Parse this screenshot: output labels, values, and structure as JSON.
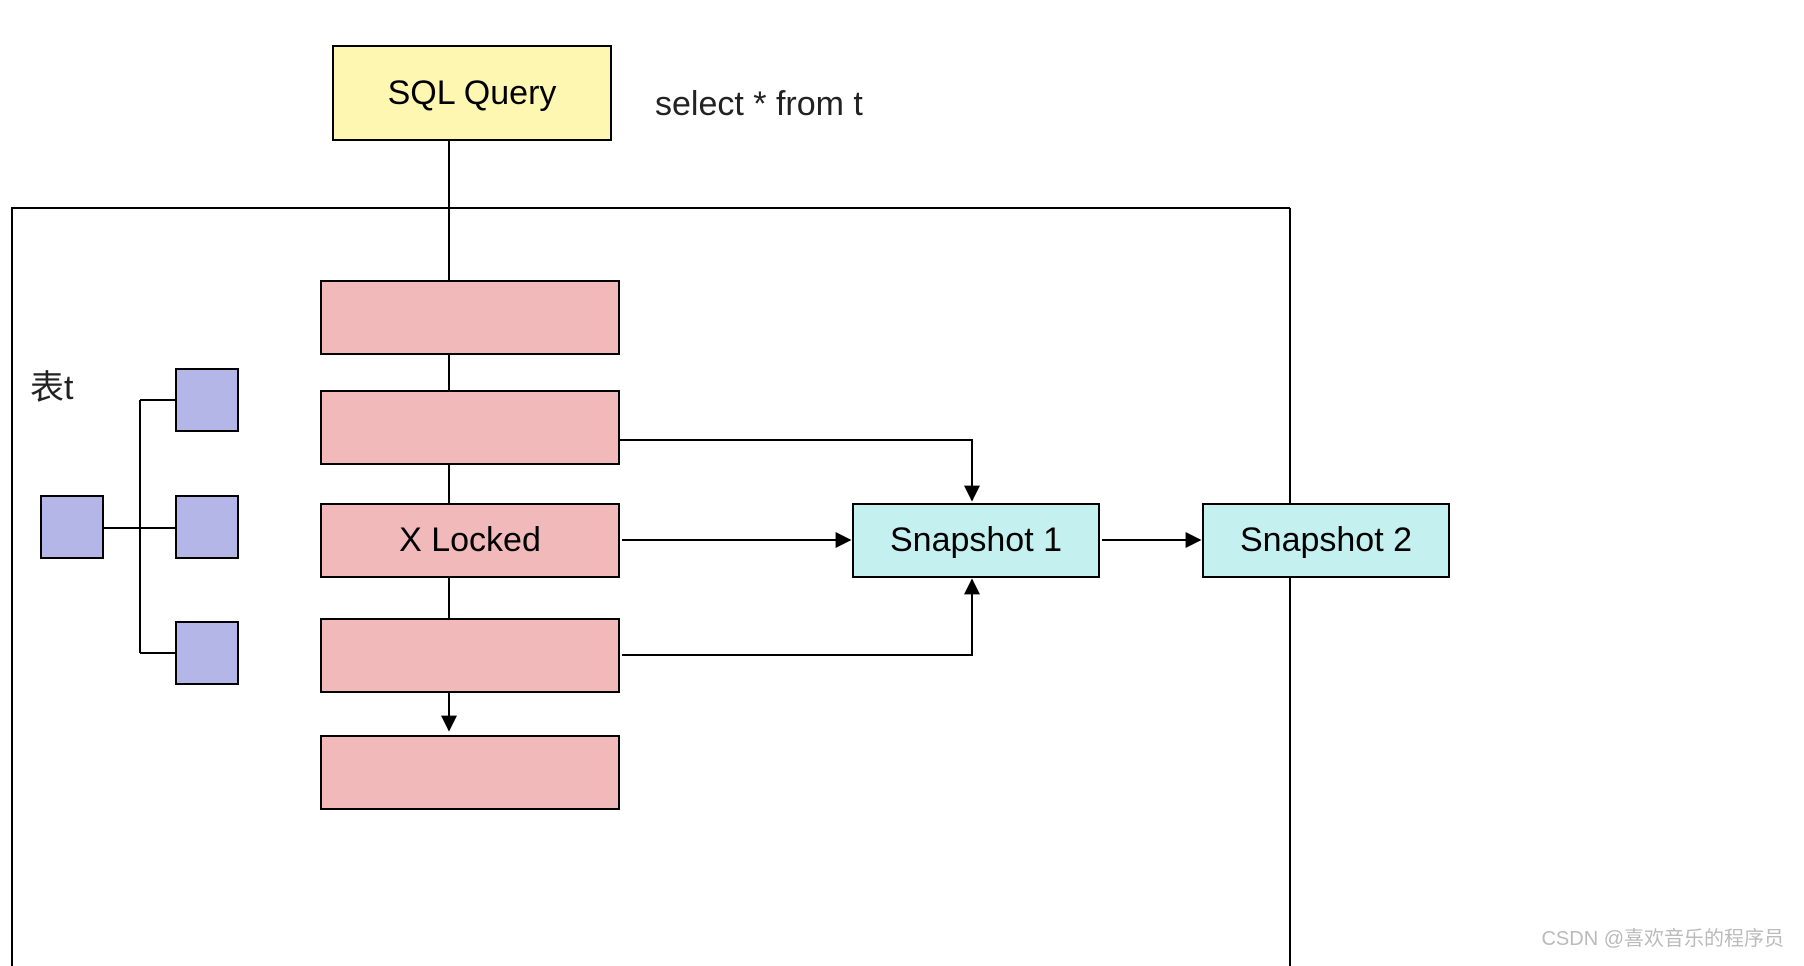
{
  "diagram": {
    "sql_query_box": "SQL Query",
    "sql_query_text": "select * from t",
    "table_label": "表t",
    "x_locked": "X Locked",
    "snapshot1": "Snapshot 1",
    "snapshot2": "Snapshot 2"
  },
  "watermark": "CSDN @喜欢音乐的程序员"
}
